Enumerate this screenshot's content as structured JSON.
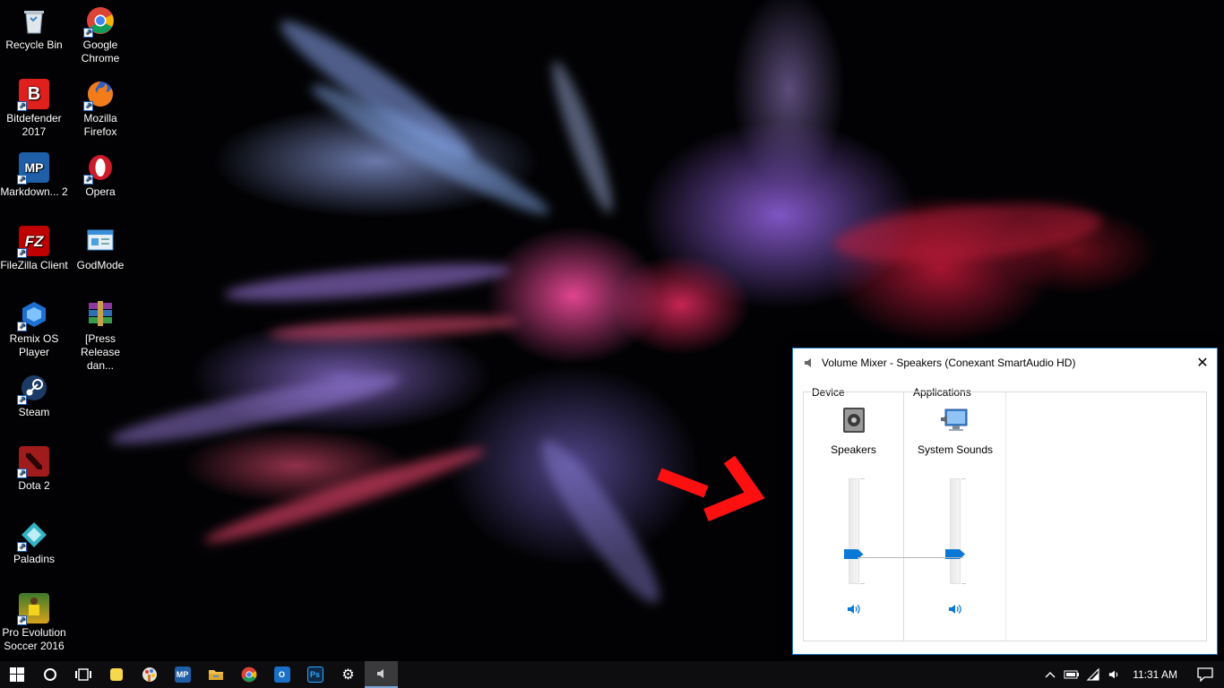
{
  "desktop": {
    "icons": [
      {
        "label": "Recycle Bin",
        "icon": "recycle-bin-icon",
        "color": "#cfd8e0"
      },
      {
        "label": "Google Chrome",
        "icon": "chrome-icon",
        "color": "#db4437"
      },
      {
        "label": "Bitdefender 2017",
        "icon": "bitdefender-icon",
        "color": "#e0201c"
      },
      {
        "label": "Mozilla Firefox",
        "icon": "firefox-icon",
        "color": "#e66000"
      },
      {
        "label": "Markdown... 2",
        "icon": "markdownpad-icon",
        "color": "#1f5fa8"
      },
      {
        "label": "Opera",
        "icon": "opera-icon",
        "color": "#cc1b2a"
      },
      {
        "label": "FileZilla Client",
        "icon": "filezilla-icon",
        "color": "#bf0000"
      },
      {
        "label": "GodMode",
        "icon": "godmode-icon",
        "color": "#3a8fd8"
      },
      {
        "label": "Remix OS Player",
        "icon": "remix-os-icon",
        "color": "#1d6fd1"
      },
      {
        "label": "[Press Release dan...",
        "icon": "winrar-archive-icon",
        "color": "#7a3a8c"
      },
      {
        "label": "Steam",
        "icon": "steam-icon",
        "color": "#1b3b66"
      },
      {
        "label": "Dota 2",
        "icon": "dota2-icon",
        "color": "#a01b1b"
      },
      {
        "label": "Paladins",
        "icon": "paladins-icon",
        "color": "#34b3c4"
      },
      {
        "label": "Pro Evolution Soccer 2016",
        "icon": "pes2016-icon",
        "color": "#d8a21c"
      }
    ]
  },
  "mixer": {
    "title": "Volume Mixer - Speakers (Conexant SmartAudio HD)",
    "close_glyph": "✕",
    "device_group": "Device",
    "apps_group": "Applications",
    "device_channel": {
      "label": "Speakers",
      "level": 0.26
    },
    "app_channel": {
      "label": "System Sounds",
      "level": 0.26
    },
    "accent": "#0a78d7"
  },
  "taskbar": {
    "time": "11:31 AM",
    "apps": [
      {
        "name": "taskbar-sticky-notes",
        "icon": "sticky-notes-icon",
        "text": "",
        "color": "#f7d84a"
      },
      {
        "name": "taskbar-paint",
        "icon": "paint-icon",
        "text": "",
        "color": "#e06a3a"
      },
      {
        "name": "taskbar-markdownpad",
        "icon": "markdownpad-icon",
        "text": "MP",
        "color": "#1f5fa8"
      },
      {
        "name": "taskbar-file-explorer",
        "icon": "folder-icon",
        "text": "",
        "color": "#f3c14b"
      },
      {
        "name": "taskbar-chrome",
        "icon": "chrome-icon",
        "text": "",
        "color": "#db4437"
      },
      {
        "name": "taskbar-outlook",
        "icon": "outlook-icon",
        "text": "O",
        "color": "#1a6fc6"
      },
      {
        "name": "taskbar-photoshop",
        "icon": "photoshop-icon",
        "text": "Ps",
        "color": "#0e2a47"
      },
      {
        "name": "taskbar-settings",
        "icon": "gear-icon",
        "text": "⚙",
        "color": "transparent"
      },
      {
        "name": "taskbar-volume-mixer",
        "icon": "speaker-icon",
        "text": "",
        "color": "transparent"
      }
    ]
  }
}
